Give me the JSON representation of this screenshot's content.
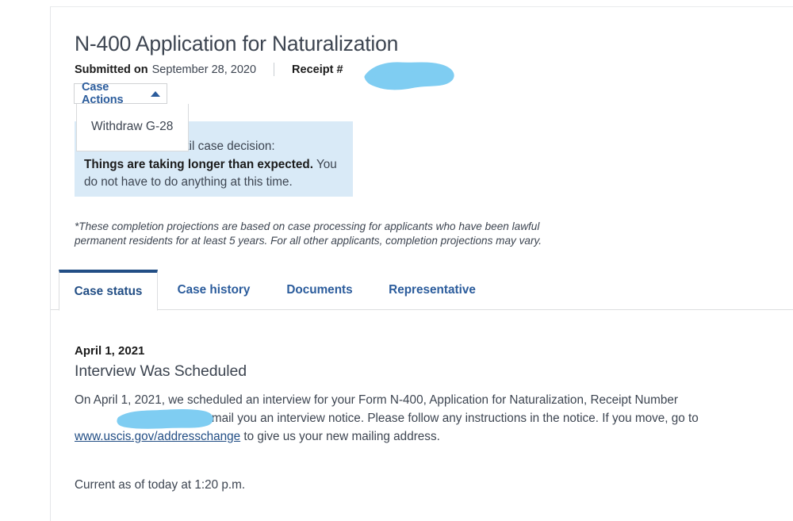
{
  "header": {
    "case_title": "N-400 Application for Naturalization",
    "submitted_label": "Submitted on",
    "submitted_date": "September 28, 2020",
    "receipt_label": "Receipt #",
    "receipt_number_redacted": ""
  },
  "case_actions": {
    "button_label": "Case Actions",
    "caret_icon": "caret-up-icon",
    "expanded": true,
    "menu_items": [
      {
        "label": "Withdraw G-28"
      }
    ]
  },
  "estimate_box": {
    "line1": "Estimated time *until case decision:",
    "line2_strong": "Things are taking longer than expected.",
    "line2_rest": " You do not have to do anything at this time.",
    "background_color": "#d9eaf7"
  },
  "projection_note": "*These completion projections are based on case processing for applicants who have been lawful permanent residents for at least 5 years. For all other applicants, completion projections may vary.",
  "tabs": {
    "active_index": 0,
    "items": [
      {
        "label": "Case status"
      },
      {
        "label": "Case history"
      },
      {
        "label": "Documents"
      },
      {
        "label": "Representative"
      }
    ]
  },
  "status_entry": {
    "date": "April 1, 2021",
    "heading": "Interview Was Scheduled",
    "body_part1": "On April 1, 2021, we scheduled an interview for your Form N-400, Application for Naturalization, Receipt Number ",
    "body_redacted": "",
    "body_part2": ". We will mail you an interview notice. Please follow any instructions in the notice. If you move, go to ",
    "link_text": "www.uscis.gov/addresschange",
    "body_part3": " to give us your new mailing address.",
    "current_as_of": "Current as of today at 1:20 p.m."
  },
  "colors": {
    "accent_blue": "#2b5c9c",
    "active_tab_bar": "#224e85",
    "info_box_bg": "#d9eaf7",
    "redaction_blue": "#7fcdf2",
    "text_primary": "#3d4551",
    "text_strong": "#1b1b1b"
  }
}
